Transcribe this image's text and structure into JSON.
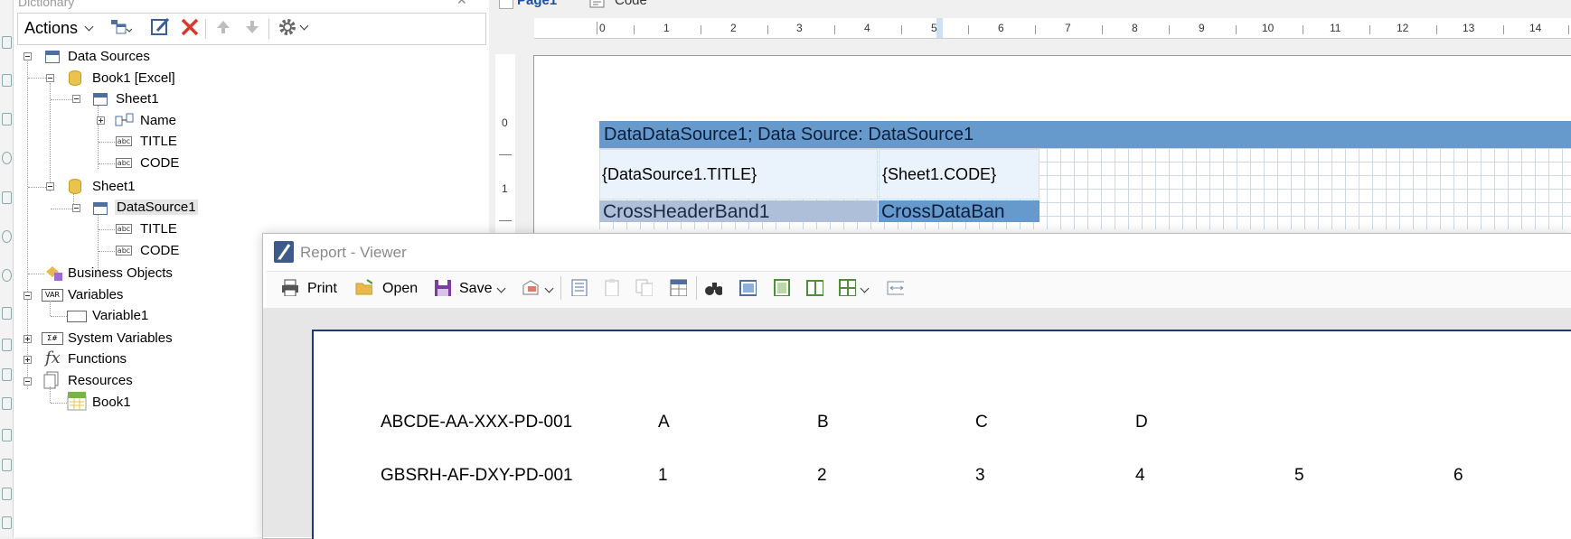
{
  "dictionary": {
    "title": "Dictionary",
    "toolbar": {
      "actions_label": "Actions"
    },
    "tree": {
      "data_sources": "Data Sources",
      "book1_excel": "Book1 [Excel]",
      "sheet1": "Sheet1",
      "name": "Name",
      "title1": "TITLE",
      "code1": "CODE",
      "sheet1_b": "Sheet1",
      "datasource1": "DataSource1",
      "title2": "TITLE",
      "code2": "CODE",
      "business_objects": "Business Objects",
      "variables": "Variables",
      "variable1": "Variable1",
      "system_variables": "System Variables",
      "functions": "Functions",
      "resources": "Resources",
      "book1": "Book1"
    }
  },
  "designer": {
    "tabs": {
      "page1": "Page1",
      "code": "Code"
    },
    "ruler_top": [
      "0",
      "1",
      "2",
      "3",
      "4",
      "5",
      "6",
      "7",
      "8",
      "9",
      "10",
      "11",
      "12",
      "13",
      "14"
    ],
    "ruler_left": [
      "0",
      "1"
    ],
    "band_header": "DataDataSource1; Data Source: DataSource1",
    "cell_title": "{DataSource1.TITLE}",
    "cell_code": "{Sheet1.CODE}",
    "cross_header": "CrossHeaderBand1",
    "cross_data": "CrossDataBan"
  },
  "viewer": {
    "title": "Report - Viewer",
    "toolbar": {
      "print": "Print",
      "open": "Open",
      "save": "Save"
    },
    "report": {
      "row1": [
        "ABCDE-AA-XXX-PD-001",
        "A",
        "B",
        "C",
        "D"
      ],
      "row2": [
        "GBSRH-AF-DXY-PD-001",
        "1",
        "2",
        "3",
        "4",
        "5",
        "6"
      ]
    }
  }
}
